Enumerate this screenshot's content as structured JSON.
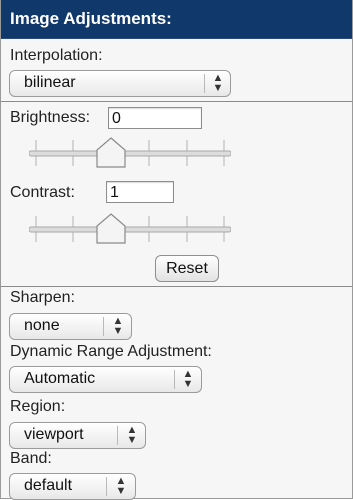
{
  "header": {
    "title": "Image Adjustments:"
  },
  "interpolation": {
    "label": "Interpolation:",
    "value": "bilinear"
  },
  "brightness": {
    "label": "Brightness:",
    "value": "0"
  },
  "contrast": {
    "label": "Contrast:",
    "value": "1"
  },
  "reset": {
    "label": "Reset"
  },
  "sharpen": {
    "label": "Sharpen:",
    "value": "none"
  },
  "dynamic_range": {
    "label": "Dynamic Range Adjustment:",
    "value": "Automatic"
  },
  "region": {
    "label": "Region:",
    "value": "viewport"
  },
  "band": {
    "label": "Band:",
    "value": "default"
  },
  "icons": {
    "select_arrows": "up-down-arrows-icon",
    "slider_thumb": "slider-thumb"
  }
}
